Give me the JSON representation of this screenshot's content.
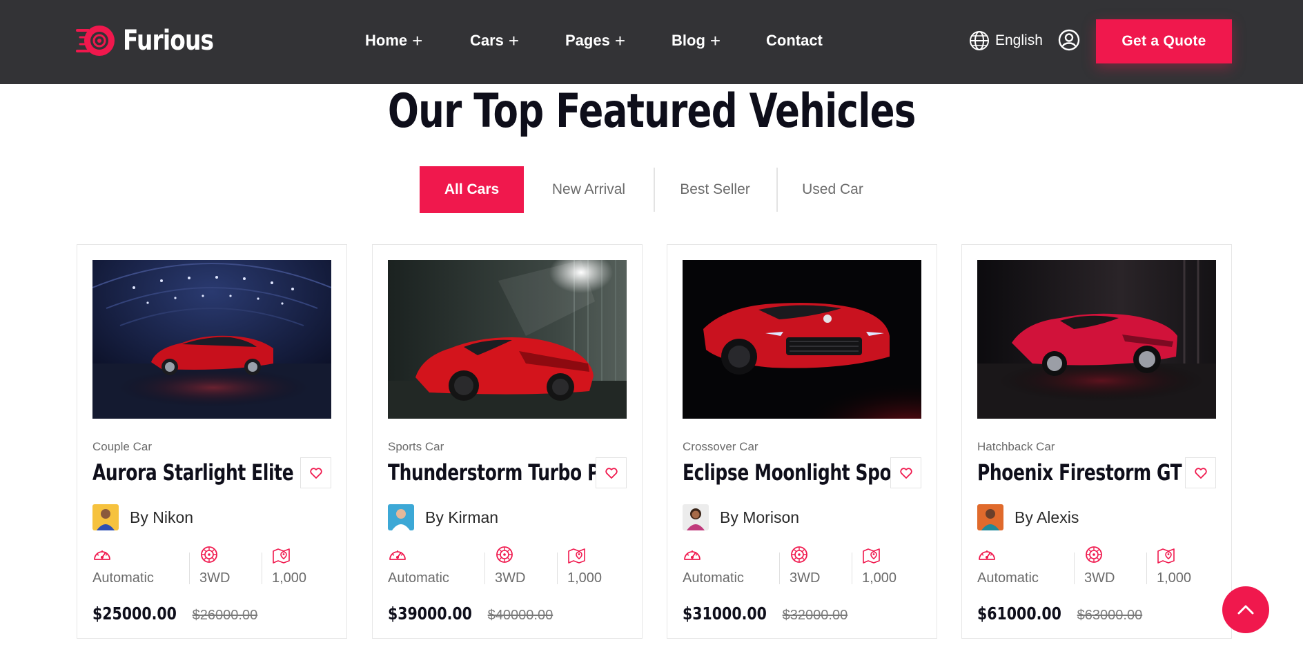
{
  "header": {
    "brand": "Furious",
    "nav": [
      {
        "label": "Home",
        "has_submenu": true
      },
      {
        "label": "Cars",
        "has_submenu": true
      },
      {
        "label": "Pages",
        "has_submenu": true
      },
      {
        "label": "Blog",
        "has_submenu": true
      },
      {
        "label": "Contact",
        "has_submenu": false
      }
    ],
    "submenu_marker": "+",
    "language": "English",
    "cta": "Get a Quote"
  },
  "section": {
    "title": "Our Top Featured Vehicles",
    "tabs": [
      "All Cars",
      "New Arrival",
      "Best Seller",
      "Used Car"
    ],
    "active_tab": "All Cars"
  },
  "cars": [
    {
      "category": "Couple Car",
      "name": "Aurora Starlight Elite",
      "author": "By Nikon",
      "transmission": "Automatic",
      "drive": "3WD",
      "mileage": "1,000",
      "price": "$25000.00",
      "old_price": "$26000.00"
    },
    {
      "category": "Sports Car",
      "name": "Thunderstorm Turbo Pro",
      "author": "By Kirman",
      "transmission": "Automatic",
      "drive": "3WD",
      "mileage": "1,000",
      "price": "$39000.00",
      "old_price": "$40000.00"
    },
    {
      "category": "Crossover Car",
      "name": "Eclipse Moonlight Sport",
      "author": "By Morison",
      "transmission": "Automatic",
      "drive": "3WD",
      "mileage": "1,000",
      "price": "$31000.00",
      "old_price": "$32000.00"
    },
    {
      "category": "Hatchback Car",
      "name": "Phoenix Firestorm GT",
      "author": "By Alexis",
      "transmission": "Automatic",
      "drive": "3WD",
      "mileage": "1,000",
      "price": "$61000.00",
      "old_price": "$63000.00"
    }
  ],
  "colors": {
    "accent": "#f0184d",
    "header_bg": "#333336",
    "heading": "#0e0e1a",
    "muted": "#6b6b6b"
  },
  "icons": {
    "logo": "wheel-logo-icon",
    "language": "globe-icon",
    "account": "user-circle-icon",
    "favorite": "heart-icon",
    "transmission": "speedometer-icon",
    "drive": "wheel-icon",
    "mileage": "map-pin-icon",
    "scroll_top": "chevron-up-icon"
  }
}
